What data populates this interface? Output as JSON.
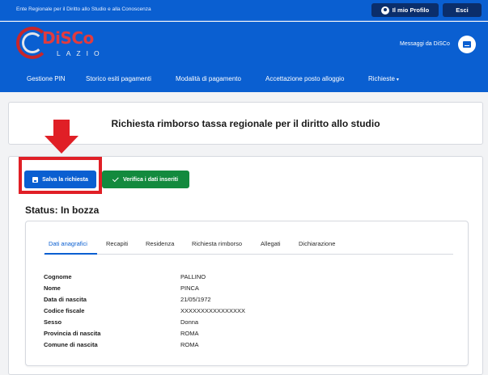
{
  "topbar": {
    "ente": "Ente Regionale per il Diritto allo Studio e alla Conoscenza",
    "profile_label": "Il mio Profilo",
    "logout_label": "Esci"
  },
  "header": {
    "logo_word": "DiSCo",
    "logo_sub": "LAZIO",
    "messages_label": "Messaggi da DiSCo"
  },
  "nav": {
    "items": [
      {
        "label": "Gestione PIN"
      },
      {
        "label": "Storico esiti pagamenti"
      },
      {
        "label": "Modalità di pagamento"
      },
      {
        "label": "Accettazione posto alloggio"
      },
      {
        "label": "Richieste"
      }
    ]
  },
  "page": {
    "title": "Richiesta rimborso tassa regionale per il diritto allo studio",
    "save_label": "Salva la richiesta",
    "verify_label": "Verifica i dati inseriti",
    "status": "Status: In bozza"
  },
  "tabs": [
    {
      "label": "Dati anagrafici",
      "active": true
    },
    {
      "label": "Recapiti"
    },
    {
      "label": "Residenza"
    },
    {
      "label": "Richiesta rimborso"
    },
    {
      "label": "Allegati"
    },
    {
      "label": "Dichiarazione"
    }
  ],
  "fields": [
    {
      "label": "Cognome",
      "value": "PALLINO"
    },
    {
      "label": "Nome",
      "value": "PINCA"
    },
    {
      "label": "Data di nascita",
      "value": "21/05/1972"
    },
    {
      "label": "Codice fiscale",
      "value": "XXXXXXXXXXXXXXXX"
    },
    {
      "label": "Sesso",
      "value": "Donna"
    },
    {
      "label": "Provincia di nascita",
      "value": "ROMA"
    },
    {
      "label": "Comune di nascita",
      "value": "ROMA"
    }
  ],
  "colors": {
    "brand_blue": "#0a5fd1",
    "dark_blue": "#0b2e6b",
    "success_green": "#138a3e",
    "annotation_red": "#e01f26"
  }
}
